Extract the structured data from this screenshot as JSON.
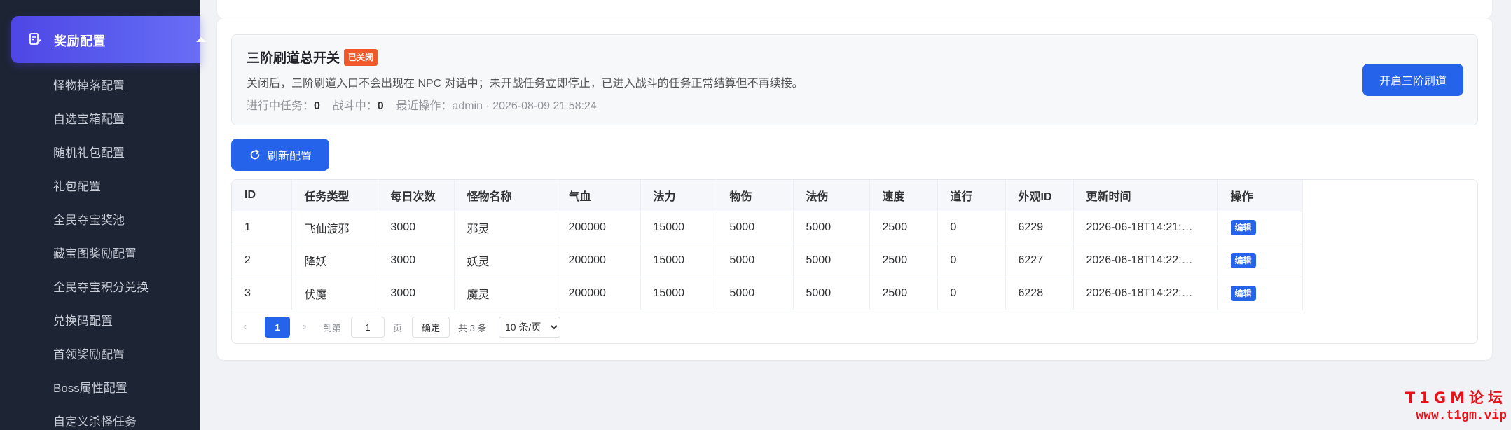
{
  "sidebar": {
    "active_menu": "奖励配置",
    "items": [
      {
        "label": "怪物掉落配置"
      },
      {
        "label": "自选宝箱配置"
      },
      {
        "label": "随机礼包配置"
      },
      {
        "label": "礼包配置"
      },
      {
        "label": "全民夺宝奖池"
      },
      {
        "label": "藏宝图奖励配置"
      },
      {
        "label": "全民夺宝积分兑换"
      },
      {
        "label": "兑换码配置"
      },
      {
        "label": "首领奖励配置"
      },
      {
        "label": "Boss属性配置"
      },
      {
        "label": "自定义杀怪任务"
      }
    ]
  },
  "switch": {
    "title": "三阶刷道总开关",
    "status_badge": "已关闭",
    "description": "关闭后，三阶刷道入口不会出现在 NPC 对话中；未开战任务立即停止，已进入战斗的任务正常结算但不再续接。",
    "stats": {
      "running_label": "进行中任务：",
      "running_value": "0",
      "battle_label": "战斗中：",
      "battle_value": "0",
      "recent_label": "最近操作：",
      "recent_value": "admin · 2026-08-09 21:58:24"
    },
    "open_button": "开启三阶刷道"
  },
  "toolbar": {
    "refresh_label": "刷新配置"
  },
  "table": {
    "headers": [
      "ID",
      "任务类型",
      "每日次数",
      "怪物名称",
      "气血",
      "法力",
      "物伤",
      "法伤",
      "速度",
      "道行",
      "外观ID",
      "更新时间",
      "操作"
    ],
    "rows": [
      {
        "cells": [
          "1",
          "飞仙渡邪",
          "3000",
          "邪灵",
          "200000",
          "15000",
          "5000",
          "5000",
          "2500",
          "0",
          "6229",
          "2026-06-18T14:21:…"
        ],
        "action": "编辑"
      },
      {
        "cells": [
          "2",
          "降妖",
          "3000",
          "妖灵",
          "200000",
          "15000",
          "5000",
          "5000",
          "2500",
          "0",
          "6227",
          "2026-06-18T14:22:…"
        ],
        "action": "编辑"
      },
      {
        "cells": [
          "3",
          "伏魔",
          "3000",
          "魔灵",
          "200000",
          "15000",
          "5000",
          "5000",
          "2500",
          "0",
          "6228",
          "2026-06-18T14:22:…"
        ],
        "action": "编辑"
      }
    ]
  },
  "pagination": {
    "current_page": "1",
    "goto_label": "到第",
    "goto_value": "1",
    "page_label": "页",
    "confirm_label": "确定",
    "total_label": "共 3 条",
    "page_size": "10 条/页"
  },
  "watermark": {
    "line1": "T1GM论坛",
    "line2": "www.t1gm.vip"
  },
  "colors": {
    "primary": "#2563eb",
    "sidebar_bg": "#1d2433",
    "active_menu": "#4f46e5",
    "closed_badge": "#f0592a",
    "watermark": "#e6121a"
  }
}
